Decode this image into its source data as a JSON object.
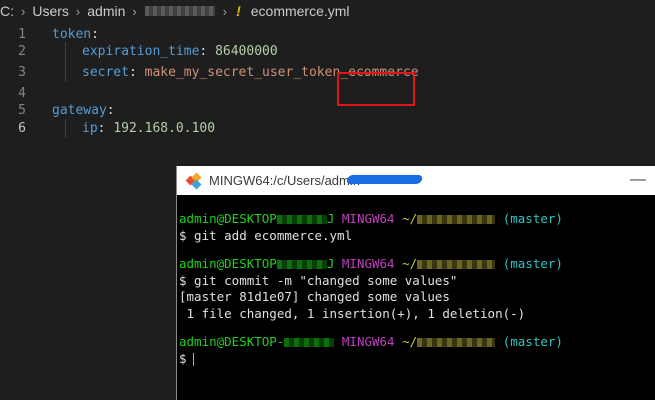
{
  "breadcrumb": {
    "drive": "C:",
    "users": "Users",
    "admin": "admin",
    "file_icon": "!",
    "file": "ecommerce.yml"
  },
  "editor": {
    "lines": [
      {
        "num": "1",
        "key": "token",
        "sep": ":",
        "value": ""
      },
      {
        "num": "2",
        "key": "expiration_time",
        "sep": ": ",
        "value": "86400000"
      },
      {
        "num": "3",
        "key": "secret",
        "sep": ": ",
        "value": "make_my_secret_user_token_ecommerce"
      },
      {
        "num": "4",
        "key": "",
        "sep": "",
        "value": ""
      },
      {
        "num": "5",
        "key": "gateway",
        "sep": ":",
        "value": ""
      },
      {
        "num": "6",
        "key": "ip",
        "sep": ": ",
        "value": "192.168.0.100"
      }
    ],
    "highlight_color": "#e0151b"
  },
  "terminal": {
    "title": "MINGW64:/c/Users/admin",
    "minimize_glyph": "—",
    "prompt_user": "admin@DESKTOP",
    "prompt_mid": "MINGW64",
    "prompt_path": "~/",
    "branch": "(master)",
    "cmd1": "$ git add ecommerce.yml",
    "cmd2": "$ git commit -m \"changed some values\"",
    "out1": "[master 81d1e07] changed some values",
    "out2": " 1 file changed, 1 insertion(+), 1 deletion(-)",
    "prompt_end": "$"
  },
  "colors": {
    "prompt_user": "#1fd11f",
    "prompt_mid": "#c13ec1",
    "prompt_path": "#c8c831",
    "branch": "#2ec4c4",
    "redact_scribble": "#1a6fe0"
  }
}
